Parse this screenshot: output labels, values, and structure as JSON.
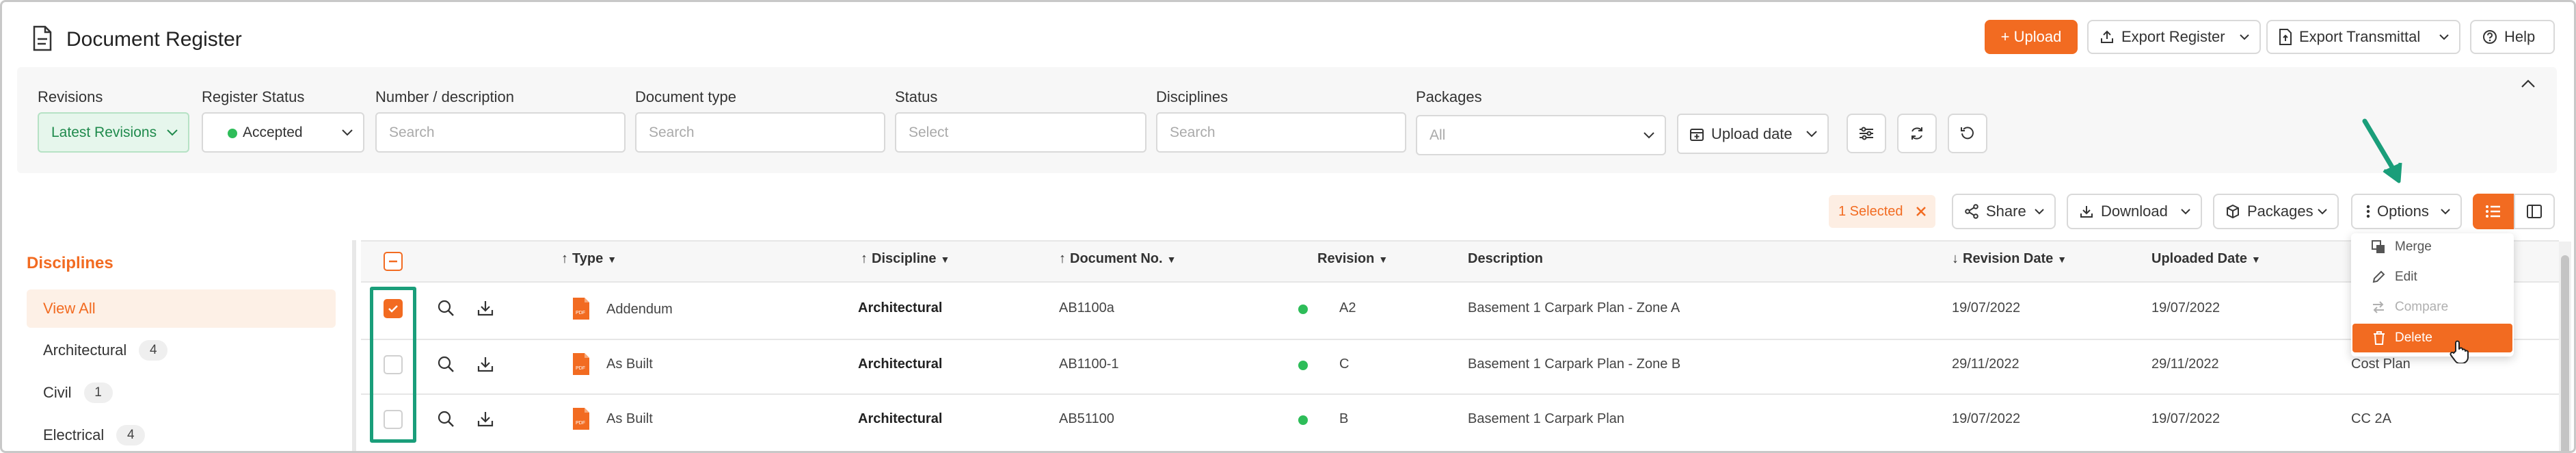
{
  "header": {
    "title": "Document Register",
    "upload_label": "+ Upload",
    "export_register_label": "Export Register",
    "export_transmittal_label": "Export Transmittal",
    "help_label": "Help"
  },
  "filters": {
    "revisions": {
      "label": "Revisions",
      "value": "Latest Revisions"
    },
    "register_status": {
      "label": "Register Status",
      "value": "Accepted"
    },
    "number_description": {
      "label": "Number / description",
      "placeholder": "Search"
    },
    "document_type": {
      "label": "Document type",
      "placeholder": "Search"
    },
    "status": {
      "label": "Status",
      "placeholder": "Select"
    },
    "disciplines": {
      "label": "Disciplines",
      "placeholder": "Search"
    },
    "packages": {
      "label": "Packages",
      "placeholder": "All"
    },
    "upload_date": {
      "value": "Upload date"
    }
  },
  "toolbar": {
    "selected_label": "1 Selected",
    "share_label": "Share",
    "download_label": "Download",
    "packages_label": "Packages",
    "options_label": "Options"
  },
  "sidebar": {
    "title": "Disciplines",
    "items": [
      {
        "label": "View All",
        "count": ""
      },
      {
        "label": "Architectural",
        "count": "4"
      },
      {
        "label": "Civil",
        "count": "1"
      },
      {
        "label": "Electrical",
        "count": "4"
      }
    ]
  },
  "table": {
    "columns": {
      "type": "Type",
      "discipline": "Discipline",
      "document_no": "Document No.",
      "revision": "Revision",
      "description": "Description",
      "revision_date": "Revision Date",
      "uploaded_date": "Uploaded Date"
    },
    "rows": [
      {
        "type": "Addendum",
        "discipline": "Architectural",
        "document_no": "AB1100a",
        "revision": "A2",
        "description": "Basement 1 Carpark Plan - Zone A",
        "revision_date": "19/07/2022",
        "uploaded_date": "19/07/2022",
        "package": "",
        "checked": true
      },
      {
        "type": "As Built",
        "discipline": "Architectural",
        "document_no": "AB1100-1",
        "revision": "C",
        "description": "Basement 1 Carpark Plan - Zone B",
        "revision_date": "29/11/2022",
        "uploaded_date": "29/11/2022",
        "package": "Cost Plan",
        "checked": false
      },
      {
        "type": "As Built",
        "discipline": "Architectural",
        "document_no": "AB51100",
        "revision": "B",
        "description": "Basement 1 Carpark Plan",
        "revision_date": "19/07/2022",
        "uploaded_date": "19/07/2022",
        "package": "CC 2A",
        "checked": false
      }
    ]
  },
  "options_menu": {
    "merge": "Merge",
    "edit": "Edit",
    "compare": "Compare",
    "delete": "Delete"
  },
  "colors": {
    "accent": "#f26b21",
    "highlight": "#1a9e7a",
    "status_dot": "#2ebd59"
  },
  "icons": [
    "document-icon",
    "upload-icon",
    "export-icon",
    "help-icon",
    "filter-settings-icon",
    "refresh-icon",
    "reset-icon",
    "share-icon",
    "download-icon",
    "package-icon",
    "options-dots-icon",
    "list-view-icon",
    "panel-view-icon",
    "magnify-icon",
    "pdf-file-icon",
    "merge-icon",
    "edit-icon",
    "compare-icon",
    "trash-icon",
    "hand-cursor-icon",
    "annotation-arrow-icon"
  ]
}
